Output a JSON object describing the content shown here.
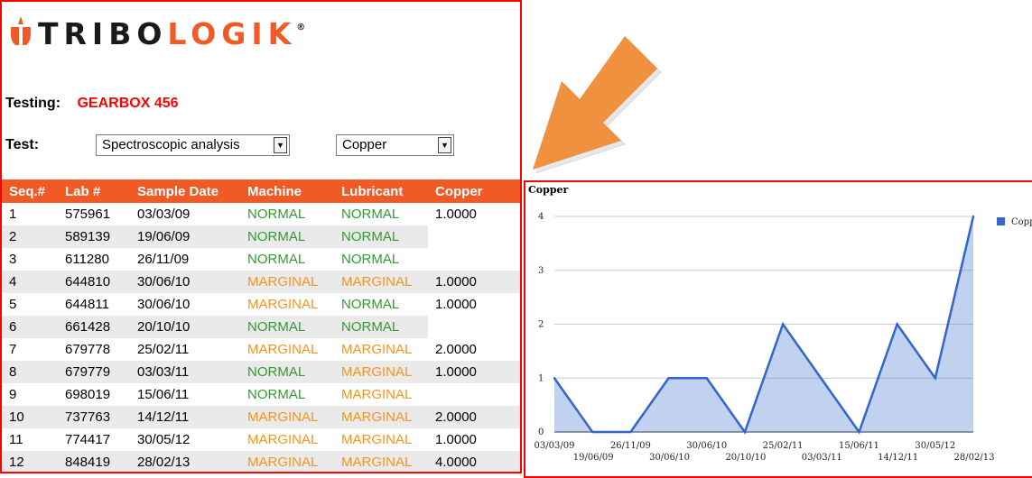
{
  "logo": {
    "text_dark": "TRIBO",
    "text_accent": "LOGIK",
    "registered": "®"
  },
  "testing": {
    "label": "Testing:",
    "value": "GEARBOX 456"
  },
  "test": {
    "label": "Test:",
    "analysis_select": "Spectroscopic analysis",
    "element_select": "Copper"
  },
  "table": {
    "headers": [
      "Seq.#",
      "Lab #",
      "Sample Date",
      "Machine",
      "Lubricant",
      "Copper"
    ],
    "rows": [
      [
        "1",
        "575961",
        "03/03/09",
        "NORMAL",
        "NORMAL",
        "1.0000"
      ],
      [
        "2",
        "589139",
        "19/06/09",
        "NORMAL",
        "NORMAL",
        ""
      ],
      [
        "3",
        "611280",
        "26/11/09",
        "NORMAL",
        "NORMAL",
        ""
      ],
      [
        "4",
        "644810",
        "30/06/10",
        "MARGINAL",
        "MARGINAL",
        "1.0000"
      ],
      [
        "5",
        "644811",
        "30/06/10",
        "MARGINAL",
        "NORMAL",
        "1.0000"
      ],
      [
        "6",
        "661428",
        "20/10/10",
        "NORMAL",
        "NORMAL",
        ""
      ],
      [
        "7",
        "679778",
        "25/02/11",
        "MARGINAL",
        "MARGINAL",
        "2.0000"
      ],
      [
        "8",
        "679779",
        "03/03/11",
        "NORMAL",
        "MARGINAL",
        "1.0000"
      ],
      [
        "9",
        "698019",
        "15/06/11",
        "NORMAL",
        "MARGINAL",
        ""
      ],
      [
        "10",
        "737763",
        "14/12/11",
        "MARGINAL",
        "MARGINAL",
        "2.0000"
      ],
      [
        "11",
        "774417",
        "30/05/12",
        "MARGINAL",
        "MARGINAL",
        "1.0000"
      ],
      [
        "12",
        "848419",
        "28/02/13",
        "MARGINAL",
        "MARGINAL",
        "4.0000"
      ]
    ]
  },
  "colors": {
    "accent": "#f15a24",
    "normal": "#339933",
    "marginal": "#f7941d",
    "series": "#3366cc",
    "frame": "#ff0000"
  },
  "chart_data": {
    "type": "area",
    "title": "Copper",
    "x": [
      "03/03/09",
      "19/06/09",
      "26/11/09",
      "30/06/10",
      "30/06/10",
      "20/10/10",
      "25/02/11",
      "03/03/11",
      "15/06/11",
      "14/12/11",
      "30/05/12",
      "28/02/13"
    ],
    "series": [
      {
        "name": "Copper",
        "values": [
          1,
          0,
          0,
          1,
          1,
          0,
          2,
          1,
          0,
          2,
          1,
          4
        ]
      }
    ],
    "yticks": [
      "0",
      "1",
      "2",
      "3",
      "4"
    ],
    "ylim": [
      0,
      4
    ],
    "grid": true,
    "legend": "right"
  }
}
